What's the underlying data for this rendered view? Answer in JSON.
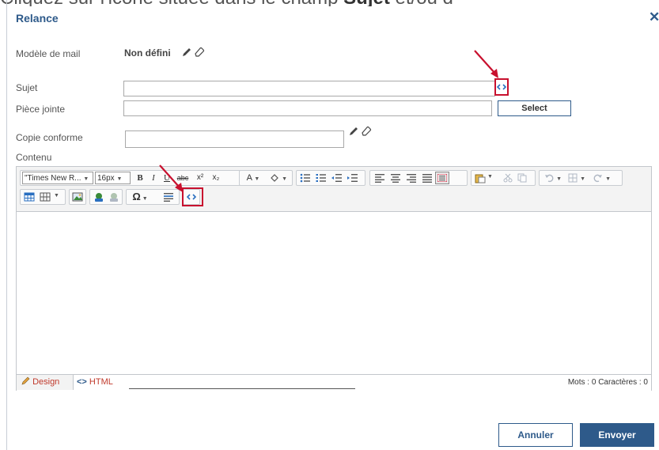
{
  "caption": {
    "before": "Cliquez sur l'icône ",
    "after": " située dans le champ ",
    "strong": "Sujet",
    "tail": " et/ou d"
  },
  "dialog": {
    "title": "Relance",
    "close": "✕"
  },
  "form": {
    "template_label": "Modèle de mail",
    "template_value": "Non défini",
    "subject_label": "Sujet",
    "subject_value": "",
    "attachment_label": "Pièce jointe",
    "attachment_value": "",
    "select_label": "Select",
    "cc_label": "Copie conforme",
    "cc_value": "",
    "content_label": "Contenu"
  },
  "editor": {
    "font_name": "\"Times New R...",
    "font_size": "16px",
    "bold": "B",
    "italic": "I",
    "underline": "U",
    "strike": "abc",
    "superscript": "x²",
    "subscript": "x₂",
    "font_color": "A",
    "special_char": "Ω",
    "design_tab": "Design",
    "html_tab": "HTML",
    "counts": "Mots : 0   Caractères : 0"
  },
  "actions": {
    "cancel": "Annuler",
    "send": "Envoyer"
  },
  "colors": {
    "brand": "#2e5a8a",
    "highlight": "#c8102e",
    "html_tab": "#c0392b"
  }
}
